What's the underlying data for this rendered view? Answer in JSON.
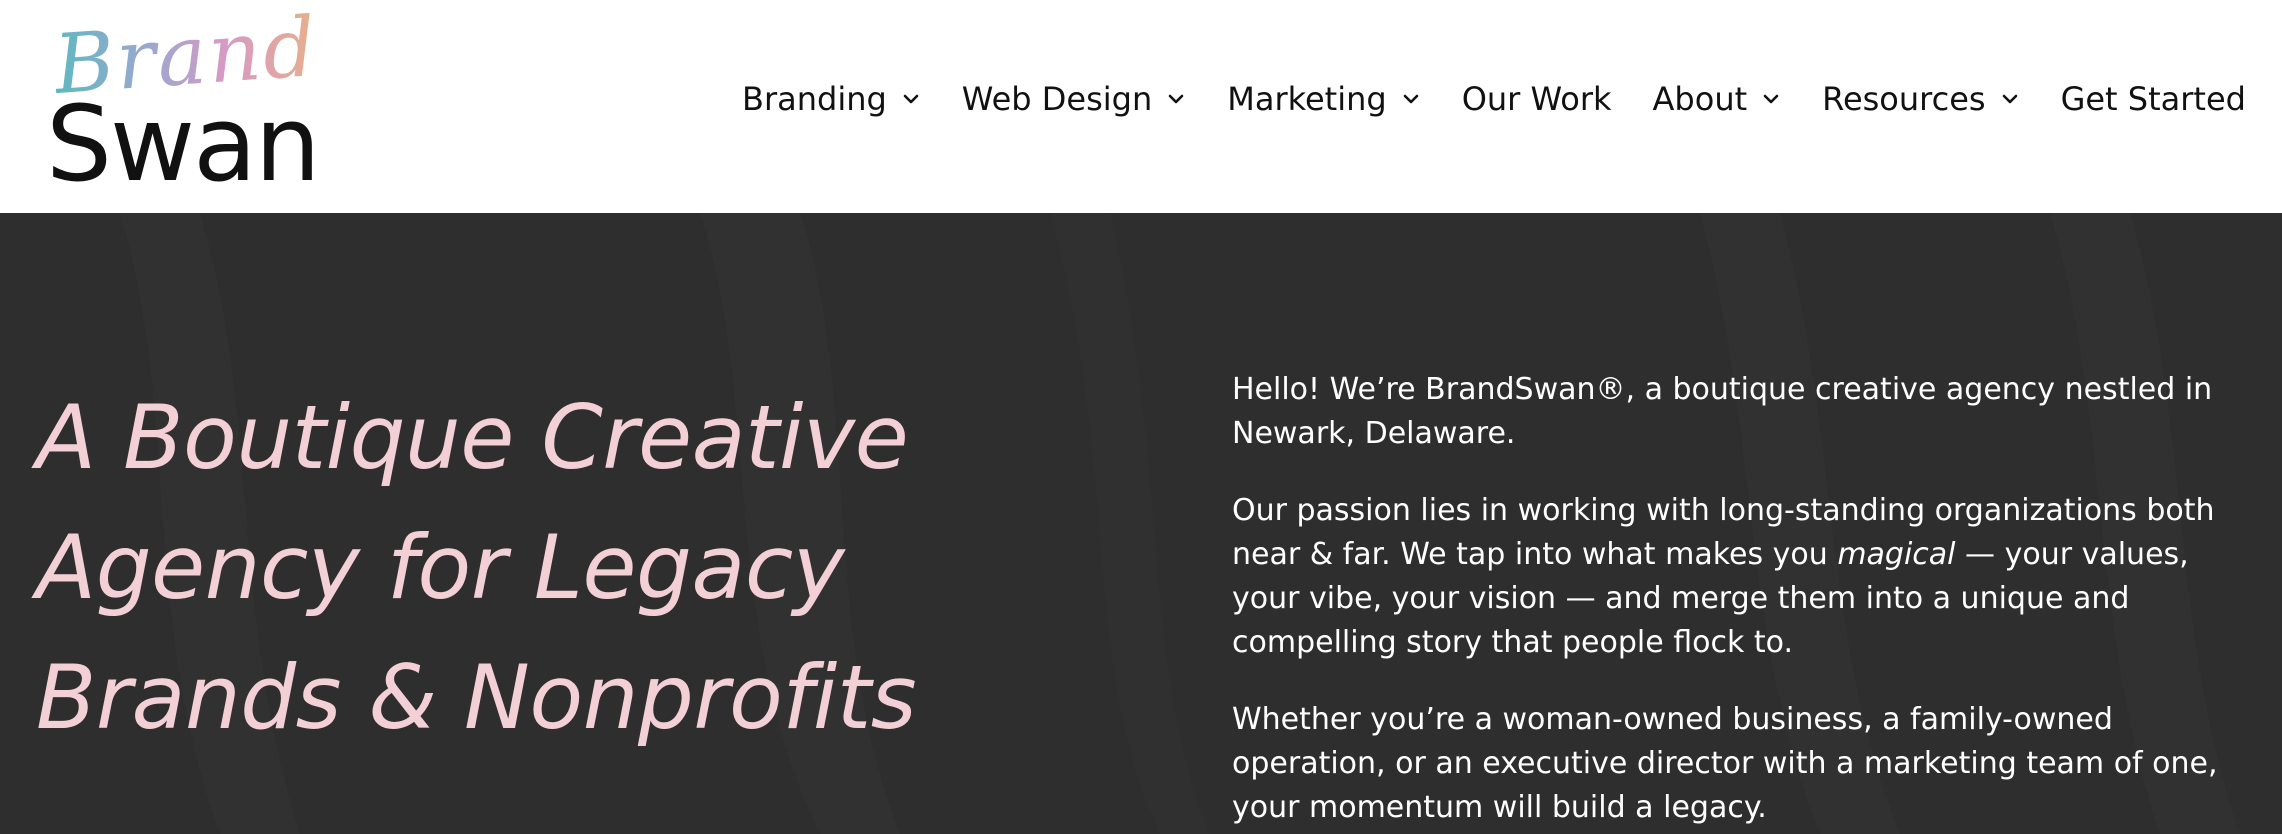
{
  "logo": {
    "script": "Brand",
    "word": "Swan",
    "mark": "®"
  },
  "nav": {
    "items": [
      {
        "label": "Branding",
        "has_dropdown": true
      },
      {
        "label": "Web Design",
        "has_dropdown": true
      },
      {
        "label": "Marketing",
        "has_dropdown": true
      },
      {
        "label": "Our Work",
        "has_dropdown": false
      },
      {
        "label": "About",
        "has_dropdown": true
      },
      {
        "label": "Resources",
        "has_dropdown": true
      },
      {
        "label": "Get Started",
        "has_dropdown": false
      }
    ]
  },
  "hero": {
    "headline": [
      "A Boutique Creative",
      "Agency for Legacy",
      "Brands & Nonprofits"
    ],
    "paragraphs": {
      "p1": "Hello! We’re BrandSwan®, a boutique creative agency nestled in Newark, Delaware.",
      "p2_before": "Our passion lies in working with long-standing organizations both near & far. We tap into what makes you ",
      "p2_em": "magical",
      "p2_after": " — your values, your vibe, your vision — and merge them into a unique and compelling story that people flock to.",
      "p3": "Whether you’re a woman-owned business, a family-owned operation, or an executive director with a marketing team of one, your momentum will build a legacy."
    }
  },
  "colors": {
    "hero_bg": "#2e2e2e",
    "headline": "#f3cfd6",
    "nav_text": "#111111",
    "body_text": "#ffffff"
  },
  "icons": {
    "dropdown": "chevron-down-icon"
  }
}
